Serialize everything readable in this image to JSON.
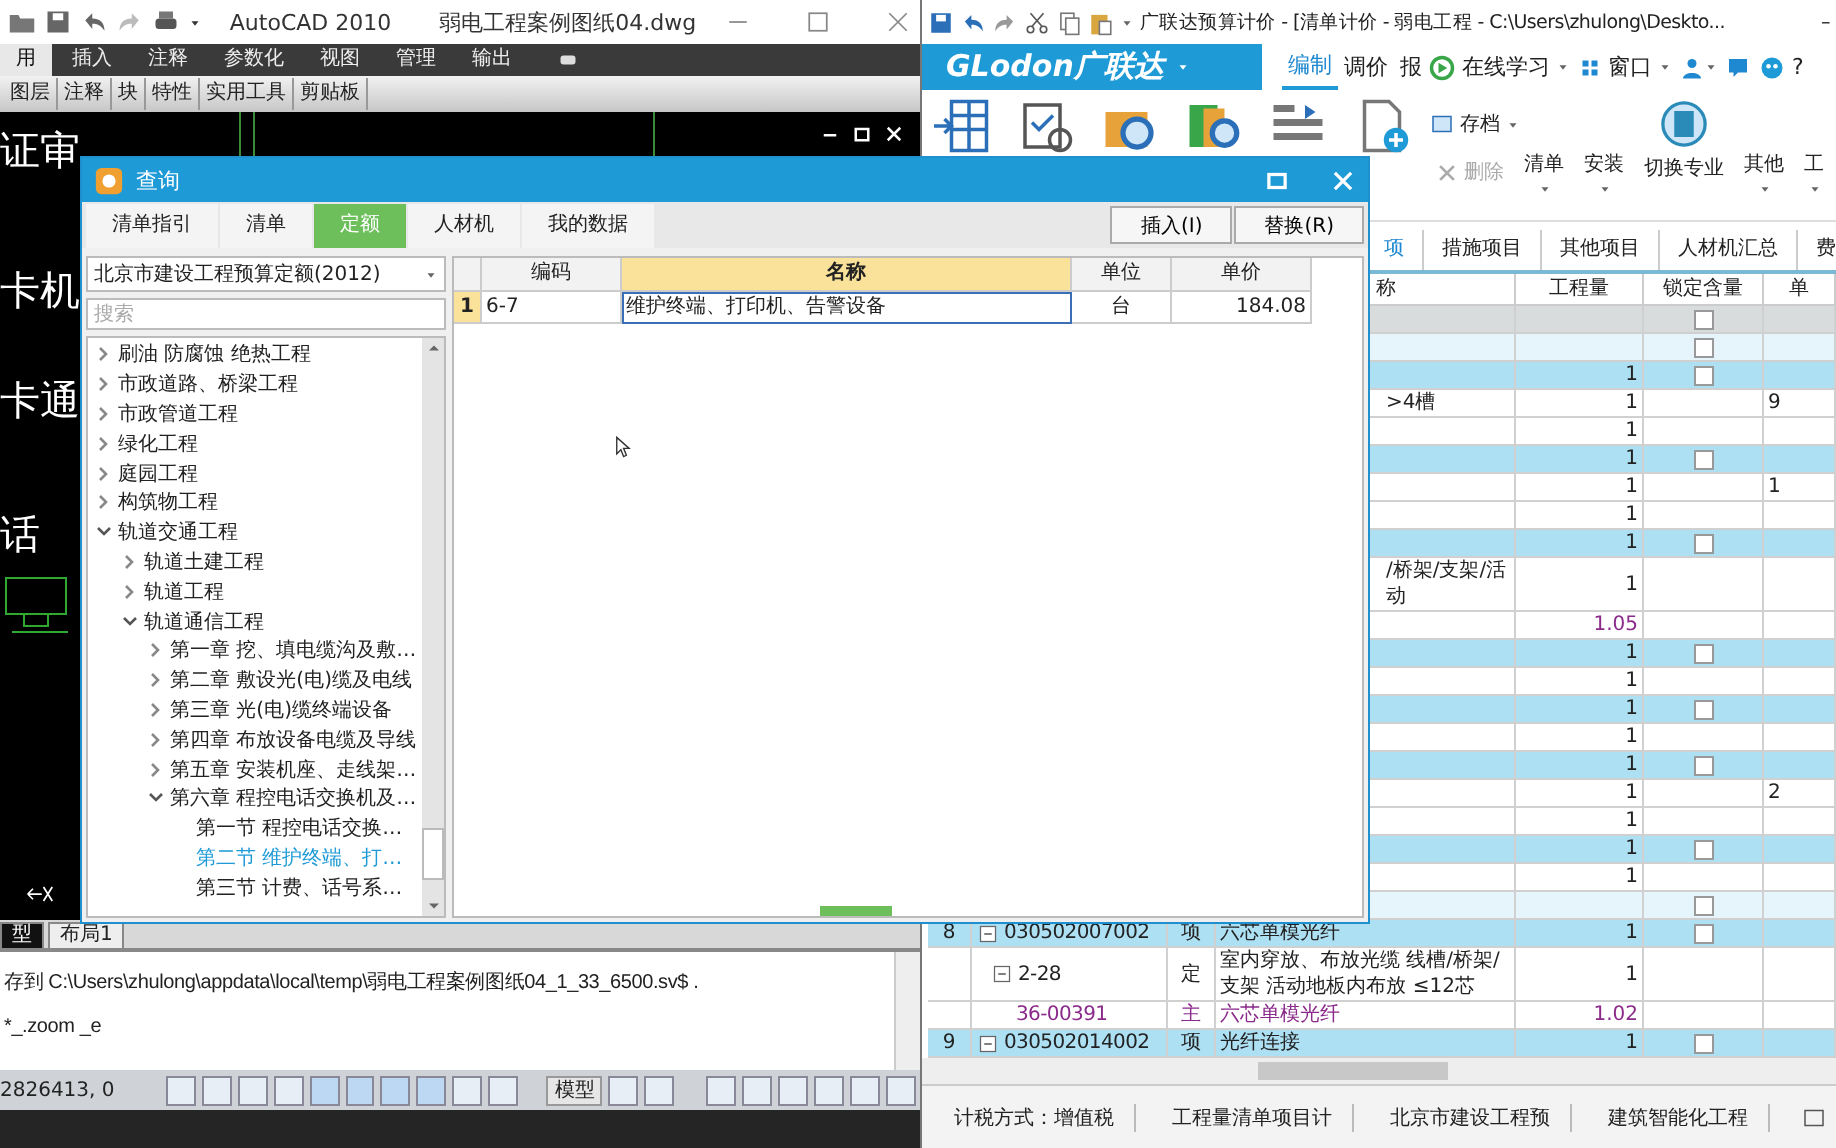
{
  "cad": {
    "title": "AutoCAD 2010",
    "file": "弱电工程案例图纸04.dwg",
    "ribbon_tabs": [
      {
        "label": "用",
        "selected": true
      },
      {
        "label": "插入",
        "selected": false
      },
      {
        "label": "注释",
        "selected": false
      },
      {
        "label": "参数化",
        "selected": false
      },
      {
        "label": "视图",
        "selected": false
      },
      {
        "label": "管理",
        "selected": false
      },
      {
        "label": "输出",
        "selected": false
      }
    ],
    "panels": [
      "图层",
      "注释",
      "块",
      "特性",
      "实用工具",
      "剪贴板"
    ],
    "drawing_texts": [
      "证审",
      "卡机",
      "卡通",
      "话"
    ],
    "layout_tabs": [
      {
        "label": "型",
        "selected": true
      },
      {
        "label": "布局1",
        "selected": false
      }
    ],
    "command_lines": [
      "存到 C:\\Users\\zhulong\\appdata\\local\\temp\\弱电工程案例图纸04_1_33_6500.sv$ .",
      "*_.zoom _e"
    ],
    "coordinates": "2826413, 0",
    "model_button": "模型"
  },
  "glodon": {
    "title": "广联达预算计价 - [清单计价 - 弱电工程 - C:\\Users\\zhulong\\Deskto...",
    "minimize": "–",
    "logo": "GLodon广联达",
    "menu": [
      {
        "label": "编制",
        "selected": true
      },
      {
        "label": "调价",
        "selected": false
      },
      {
        "label": "报",
        "selected": false
      }
    ],
    "online": "在线学习",
    "window_menu": "窗口",
    "help": "?",
    "tools": [
      {
        "label": "存档",
        "kind": "small",
        "disabled": false
      },
      {
        "label": "删除",
        "kind": "small",
        "disabled": true
      },
      {
        "label": "清单",
        "kind": "menu",
        "disabled": false
      },
      {
        "label": "安装",
        "kind": "menu",
        "disabled": false
      },
      {
        "label": "切换专业",
        "kind": "large",
        "disabled": false
      },
      {
        "label": "其他",
        "kind": "menu",
        "disabled": false
      },
      {
        "label": "工",
        "kind": "menu",
        "disabled": false
      }
    ],
    "tabs": [
      {
        "label": "项",
        "selected": true
      },
      {
        "label": "措施项目",
        "selected": false
      },
      {
        "label": "其他项目",
        "selected": false
      },
      {
        "label": "人材机汇总",
        "selected": false
      },
      {
        "label": "费",
        "selected": false
      }
    ],
    "grid": {
      "columns": [
        "称",
        "工程量",
        "锁定含量",
        "单"
      ],
      "covered_rows": [
        {
          "kind": "project",
          "checked": false
        },
        {
          "kind": "section",
          "checked": false
        },
        {
          "kind": "item",
          "qty": "1",
          "checked": false
        },
        {
          "kind": "quota",
          "name_tail": ">4槽",
          "qty": "1",
          "price_head": "9"
        },
        {
          "kind": "quota",
          "qty": "1"
        },
        {
          "kind": "item",
          "qty": "1",
          "checked": false
        },
        {
          "kind": "quota",
          "qty": "1",
          "price_head": "1"
        },
        {
          "kind": "quota",
          "qty": "1"
        },
        {
          "kind": "item",
          "qty": "1",
          "checked": false
        },
        {
          "kind": "quota",
          "name_tail": "/桥架/支架/活动",
          "qty": "1"
        },
        {
          "kind": "material",
          "qty": "1.05"
        },
        {
          "kind": "item",
          "qty": "1",
          "checked": false
        },
        {
          "kind": "quota",
          "qty": "1"
        },
        {
          "kind": "item",
          "qty": "1",
          "checked": false
        },
        {
          "kind": "quota",
          "qty": "1"
        },
        {
          "kind": "item",
          "qty": "1",
          "checked": false
        },
        {
          "kind": "quota",
          "qty": "1",
          "price_head": "2"
        },
        {
          "kind": "quota",
          "qty": "1"
        },
        {
          "kind": "item",
          "qty": "1",
          "checked": false
        },
        {
          "kind": "quota",
          "qty": "1"
        },
        {
          "kind": "section",
          "checked": false
        }
      ],
      "rows": [
        {
          "kind": "item",
          "seq": "8",
          "code": "030502007002",
          "expanded": true,
          "type": "项",
          "name": "六芯单模光纤",
          "qty": "1",
          "checked": false
        },
        {
          "kind": "quota",
          "code": "2-28",
          "expanded": true,
          "type": "定",
          "name": "室内穿放、布放光缆 线槽/桥架/支架 活动地板内布放 ≤12芯",
          "qty": "1"
        },
        {
          "kind": "material",
          "code": "36-00391",
          "type": "主",
          "name": "六芯单模光纤",
          "qty": "1.02"
        },
        {
          "kind": "item",
          "seq": "9",
          "code": "030502014002",
          "expanded": true,
          "type": "项",
          "name": "光纤连接",
          "qty": "1",
          "checked": false
        }
      ]
    },
    "status_bar": [
      "计税方式：增值税",
      "工程量清单项目计",
      "北京市建设工程预",
      "建筑智能化工程"
    ]
  },
  "dialog": {
    "title": "查询",
    "tabs": [
      {
        "label": "清单指引",
        "selected": false
      },
      {
        "label": "清单",
        "selected": false
      },
      {
        "label": "定额",
        "selected": true
      },
      {
        "label": "人材机",
        "selected": false
      },
      {
        "label": "我的数据",
        "selected": false
      }
    ],
    "buttons": [
      "插入(I)",
      "替换(R)"
    ],
    "library": "北京市建设工程预算定额(2012)",
    "search": {
      "placeholder": "搜索"
    },
    "tree": [
      {
        "label": "刷油 防腐蚀 绝热工程",
        "expanded": false,
        "selected": false
      },
      {
        "label": "市政道路、桥梁工程",
        "expanded": false,
        "selected": false
      },
      {
        "label": "市政管道工程",
        "expanded": false,
        "selected": false
      },
      {
        "label": "绿化工程",
        "expanded": false,
        "selected": false
      },
      {
        "label": "庭园工程",
        "expanded": false,
        "selected": false
      },
      {
        "label": "构筑物工程",
        "expanded": false,
        "selected": false
      },
      {
        "label": "轨道交通工程",
        "expanded": true,
        "selected": false,
        "children": [
          {
            "label": "轨道土建工程",
            "expanded": false,
            "selected": false
          },
          {
            "label": "轨道工程",
            "expanded": false,
            "selected": false
          },
          {
            "label": "轨道通信工程",
            "expanded": true,
            "selected": false,
            "children": [
              {
                "label": "第一章 挖、填电缆沟及敷…",
                "expanded": false,
                "selected": false
              },
              {
                "label": "第二章 敷设光(电)缆及电线",
                "expanded": false,
                "selected": false
              },
              {
                "label": "第三章 光(电)缆终端设备",
                "expanded": false,
                "selected": false
              },
              {
                "label": "第四章 布放设备电缆及导线",
                "expanded": false,
                "selected": false
              },
              {
                "label": "第五章 安装机座、走线架…",
                "expanded": false,
                "selected": false
              },
              {
                "label": "第六章 程控电话交换机及…",
                "expanded": true,
                "selected": false,
                "children": [
                  {
                    "label": "第一节 程控电话交换…",
                    "selected": false
                  },
                  {
                    "label": "第二节 维护终端、打…",
                    "selected": true
                  },
                  {
                    "label": "第三节 计费、话号系…",
                    "selected": false
                  }
                ]
              }
            ]
          }
        ]
      }
    ],
    "table": {
      "columns": [
        "编码",
        "名称",
        "单位",
        "单价"
      ],
      "rows": [
        {
          "index": "1",
          "code": "6-7",
          "name": "维护终端、打印机、告警设备",
          "unit": "台",
          "price": "184.08"
        }
      ]
    }
  }
}
